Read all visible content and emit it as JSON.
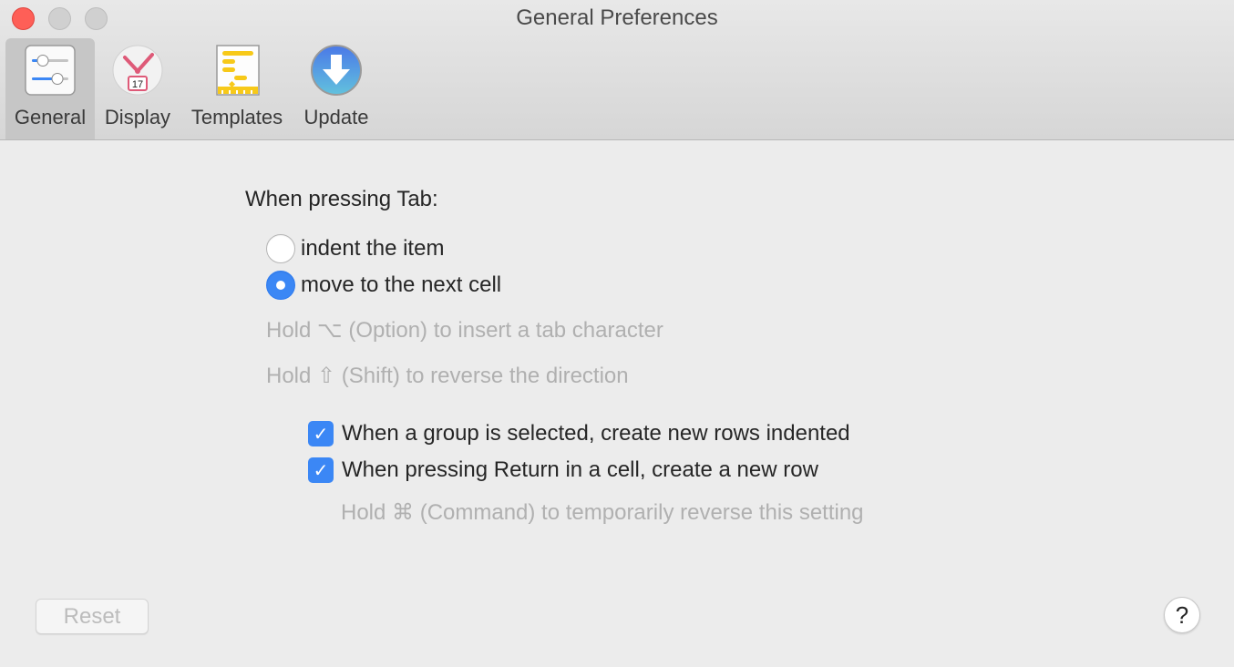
{
  "window": {
    "title": "General Preferences"
  },
  "toolbar": {
    "items": [
      {
        "label": "General",
        "icon": "sliders-icon",
        "selected": true
      },
      {
        "label": "Display",
        "icon": "clock-calendar-icon",
        "selected": false,
        "icon_text": "17"
      },
      {
        "label": "Templates",
        "icon": "gantt-template-icon",
        "selected": false
      },
      {
        "label": "Update",
        "icon": "download-arrow-icon",
        "selected": false
      }
    ]
  },
  "tab_behavior": {
    "label": "When pressing Tab:",
    "options": [
      {
        "label": "indent the item",
        "selected": false
      },
      {
        "label": "move to the next cell",
        "selected": true
      }
    ],
    "hints": [
      "Hold ⌥ (Option) to insert a tab character",
      "Hold ⇧ (Shift) to reverse the direction"
    ]
  },
  "checkboxes": [
    {
      "label": "When a group is selected, create new rows indented",
      "checked": true
    },
    {
      "label": "When pressing Return in a cell, create a new row",
      "checked": true
    }
  ],
  "return_hint": "Hold ⌘ (Command) to temporarily reverse this setting",
  "footer": {
    "reset_label": "Reset",
    "help_label": "?"
  },
  "colors": {
    "accent": "#3b87f5",
    "close": "#fe5f57"
  }
}
